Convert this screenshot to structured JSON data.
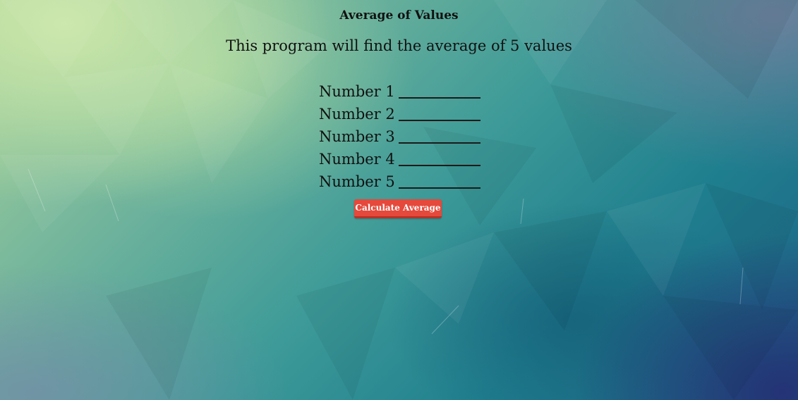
{
  "page": {
    "title": "Average of Values",
    "subtitle": "This program will find the average of 5 values"
  },
  "form": {
    "fields": [
      {
        "label": "Number 1",
        "value": "",
        "placeholder": ""
      },
      {
        "label": "Number 2",
        "value": "",
        "placeholder": ""
      },
      {
        "label": "Number 3",
        "value": "",
        "placeholder": ""
      },
      {
        "label": "Number 4",
        "value": "",
        "placeholder": ""
      },
      {
        "label": "Number 5",
        "value": "",
        "placeholder": ""
      }
    ],
    "submit_label": "Calculate Average"
  },
  "colors": {
    "button": "#e5493b",
    "background_top_left": "#a8d29a",
    "background_bottom_right": "#1e5f86"
  }
}
